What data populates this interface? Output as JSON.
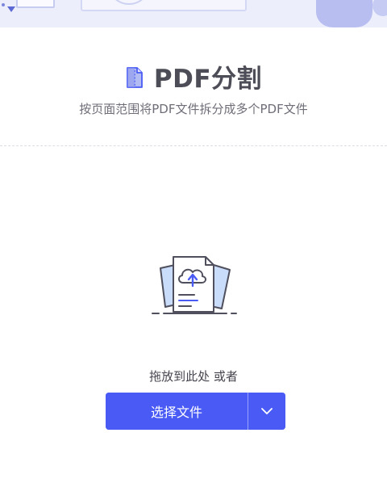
{
  "header": {
    "title": "PDF分割",
    "subtitle": "按页面范围将PDF文件拆分成多个PDF文件",
    "icon": "split-pdf-icon"
  },
  "dropzone": {
    "hint": "拖放到此处 或者",
    "illustration_icon": "cloud-upload-document-icon",
    "select_button_label": "选择文件",
    "dropdown_icon": "chevron-down-icon"
  },
  "colors": {
    "accent": "#4a5bf5",
    "title": "#4d4d57",
    "subtitle": "#6e6e78",
    "banner_bg": "#eceefb"
  }
}
